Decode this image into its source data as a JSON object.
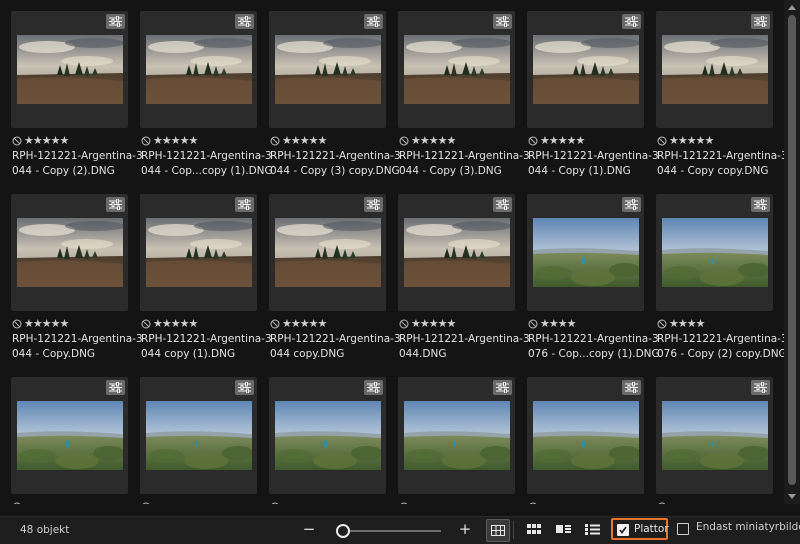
{
  "tiles": [
    {
      "name_line1": "RPH-121221-Argentina-3",
      "name_line2": "044 - Copy (2).DNG",
      "stars": "★★★★★",
      "scene": "dusk"
    },
    {
      "name_line1": "RPH-121221-Argentina-3",
      "name_line2": "044 - Cop...copy (1).DNG",
      "stars": "★★★★★",
      "scene": "dusk"
    },
    {
      "name_line1": "RPH-121221-Argentina-3",
      "name_line2": "044 - Copy (3) copy.DNG",
      "stars": "★★★★★",
      "scene": "dusk"
    },
    {
      "name_line1": "RPH-121221-Argentina-3",
      "name_line2": "044 - Copy (3).DNG",
      "stars": "★★★★★",
      "scene": "dusk"
    },
    {
      "name_line1": "RPH-121221-Argentina-3",
      "name_line2": "044 - Copy (1).DNG",
      "stars": "★★★★★",
      "scene": "dusk"
    },
    {
      "name_line1": "RPH-121221-Argentina-3",
      "name_line2": "044 - Copy copy.DNG",
      "stars": "★★★★★",
      "scene": "dusk"
    },
    {
      "name_line1": "RPH-121221-Argentina-3",
      "name_line2": "044 - Copy.DNG",
      "stars": "★★★★★",
      "scene": "dusk"
    },
    {
      "name_line1": "RPH-121221-Argentina-3",
      "name_line2": "044 copy (1).DNG",
      "stars": "★★★★★",
      "scene": "dusk"
    },
    {
      "name_line1": "RPH-121221-Argentina-3",
      "name_line2": "044 copy.DNG",
      "stars": "★★★★★",
      "scene": "dusk"
    },
    {
      "name_line1": "RPH-121221-Argentina-3",
      "name_line2": "044.DNG",
      "stars": "★★★★★",
      "scene": "dusk"
    },
    {
      "name_line1": "RPH-121221-Argentina-3",
      "name_line2": "076 - Cop...copy (1).DNG",
      "stars": "★★★★",
      "scene": "bright"
    },
    {
      "name_line1": "RPH-121221-Argentina-3",
      "name_line2": "076 - Copy (2) copy.DNG",
      "stars": "★★★★",
      "scene": "bright"
    },
    {
      "name_line1": "",
      "name_line2": "",
      "stars": "",
      "scene": "bright"
    },
    {
      "name_line1": "",
      "name_line2": "",
      "stars": "",
      "scene": "bright"
    },
    {
      "name_line1": "",
      "name_line2": "",
      "stars": "",
      "scene": "bright"
    },
    {
      "name_line1": "",
      "name_line2": "",
      "stars": "",
      "scene": "bright"
    },
    {
      "name_line1": "",
      "name_line2": "",
      "stars": "",
      "scene": "bright"
    },
    {
      "name_line1": "",
      "name_line2": "",
      "stars": "",
      "scene": "bright"
    }
  ],
  "footer": {
    "count": "48 objekt",
    "zoom_minus": "−",
    "zoom_plus": "+",
    "zoom_level": 0.05,
    "tiles_label": "Plattor",
    "tiles_checked": true,
    "thumbs_only_label": "Endast miniatyrbilder",
    "thumbs_only_checked": false
  },
  "icons": {
    "adjust": "sliders-icon",
    "reject": "reject-icon",
    "views": [
      "grid-view-icon",
      "large-grid-icon",
      "detail-view-icon",
      "list-view-icon"
    ]
  },
  "colors": {
    "accent": "#e8742b",
    "background": "#141414",
    "tile": "#2b2b2b"
  }
}
